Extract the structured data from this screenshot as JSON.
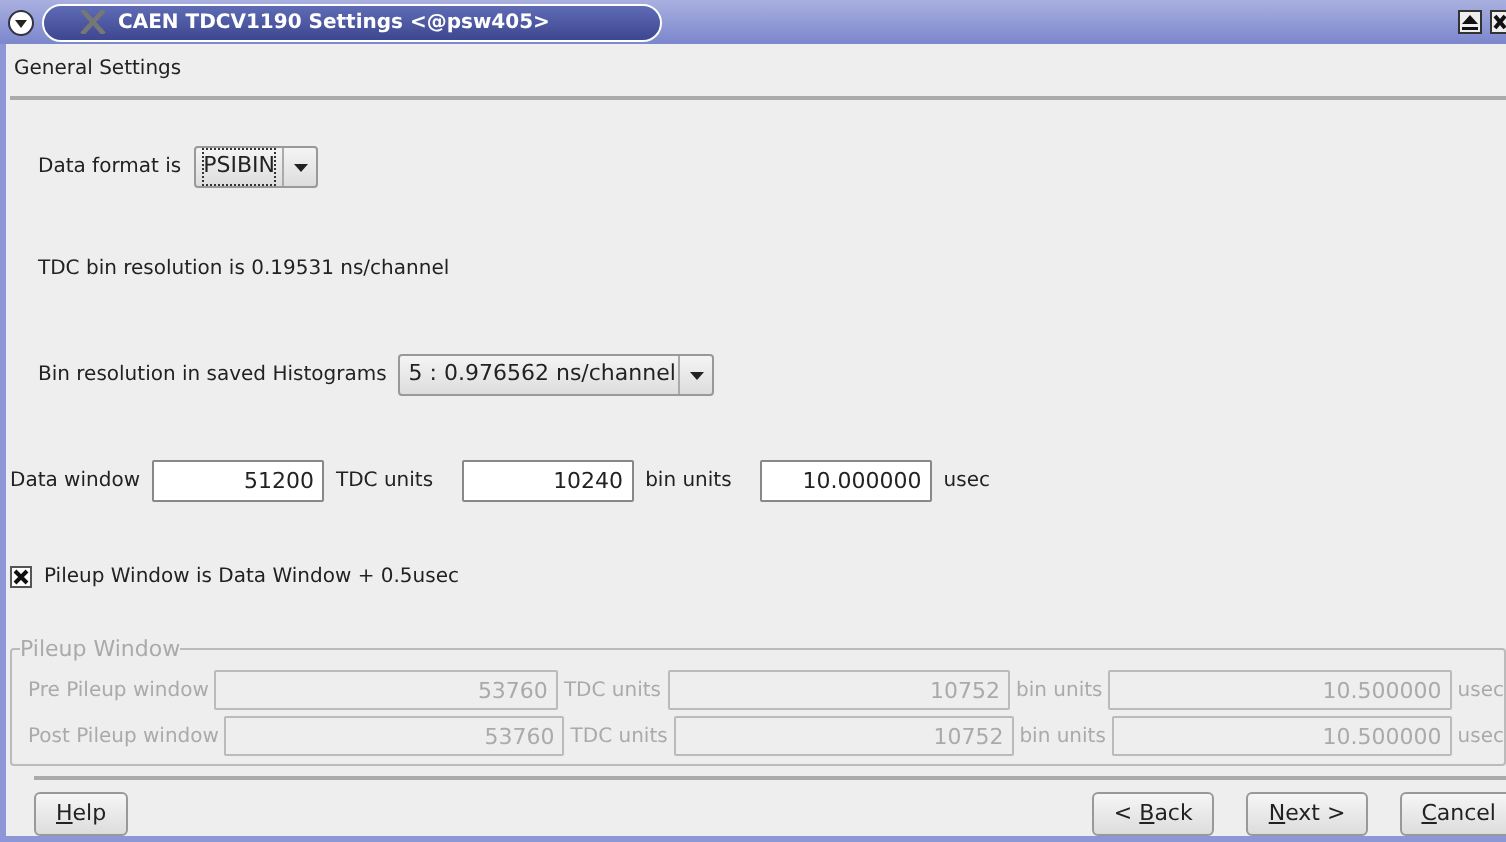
{
  "window": {
    "title": "CAEN TDCV1190 Settings <@psw405>"
  },
  "section_title": "General Settings",
  "data_format": {
    "label": "Data format is",
    "value": "PSIBIN",
    "focused": true
  },
  "tdc_resolution": "TDC bin resolution is 0.19531 ns/channel",
  "bin_resolution": {
    "label": "Bin resolution in saved Histograms",
    "value": "5 : 0.976562 ns/channel"
  },
  "data_window": {
    "label": "Data window",
    "fields": [
      {
        "value": "51200",
        "unit": "TDC units"
      },
      {
        "value": "10240",
        "unit": "bin units"
      },
      {
        "value": "10.000000",
        "unit": "usec"
      }
    ]
  },
  "pileup_checkbox": {
    "label": "Pileup Window is Data Window + 0.5usec",
    "checked": true
  },
  "pileup_window": {
    "title": "Pileup Window",
    "disabled": true,
    "rows": [
      {
        "label": "Pre Pileup window",
        "fields": [
          {
            "value": "53760",
            "unit": "TDC units"
          },
          {
            "value": "10752",
            "unit": "bin units"
          },
          {
            "value": "10.500000",
            "unit": "usec"
          }
        ]
      },
      {
        "label": "Post Pileup window",
        "fields": [
          {
            "value": "53760",
            "unit": "TDC units"
          },
          {
            "value": "10752",
            "unit": "bin units"
          },
          {
            "value": "10.500000",
            "unit": "usec"
          }
        ]
      }
    ]
  },
  "buttons": [
    {
      "key": "H",
      "after": "elp"
    },
    {
      "before": "< ",
      "key": "B",
      "after": "ack"
    },
    {
      "key": "N",
      "after": "ext >"
    },
    {
      "key": "C",
      "after": "ancel"
    }
  ]
}
